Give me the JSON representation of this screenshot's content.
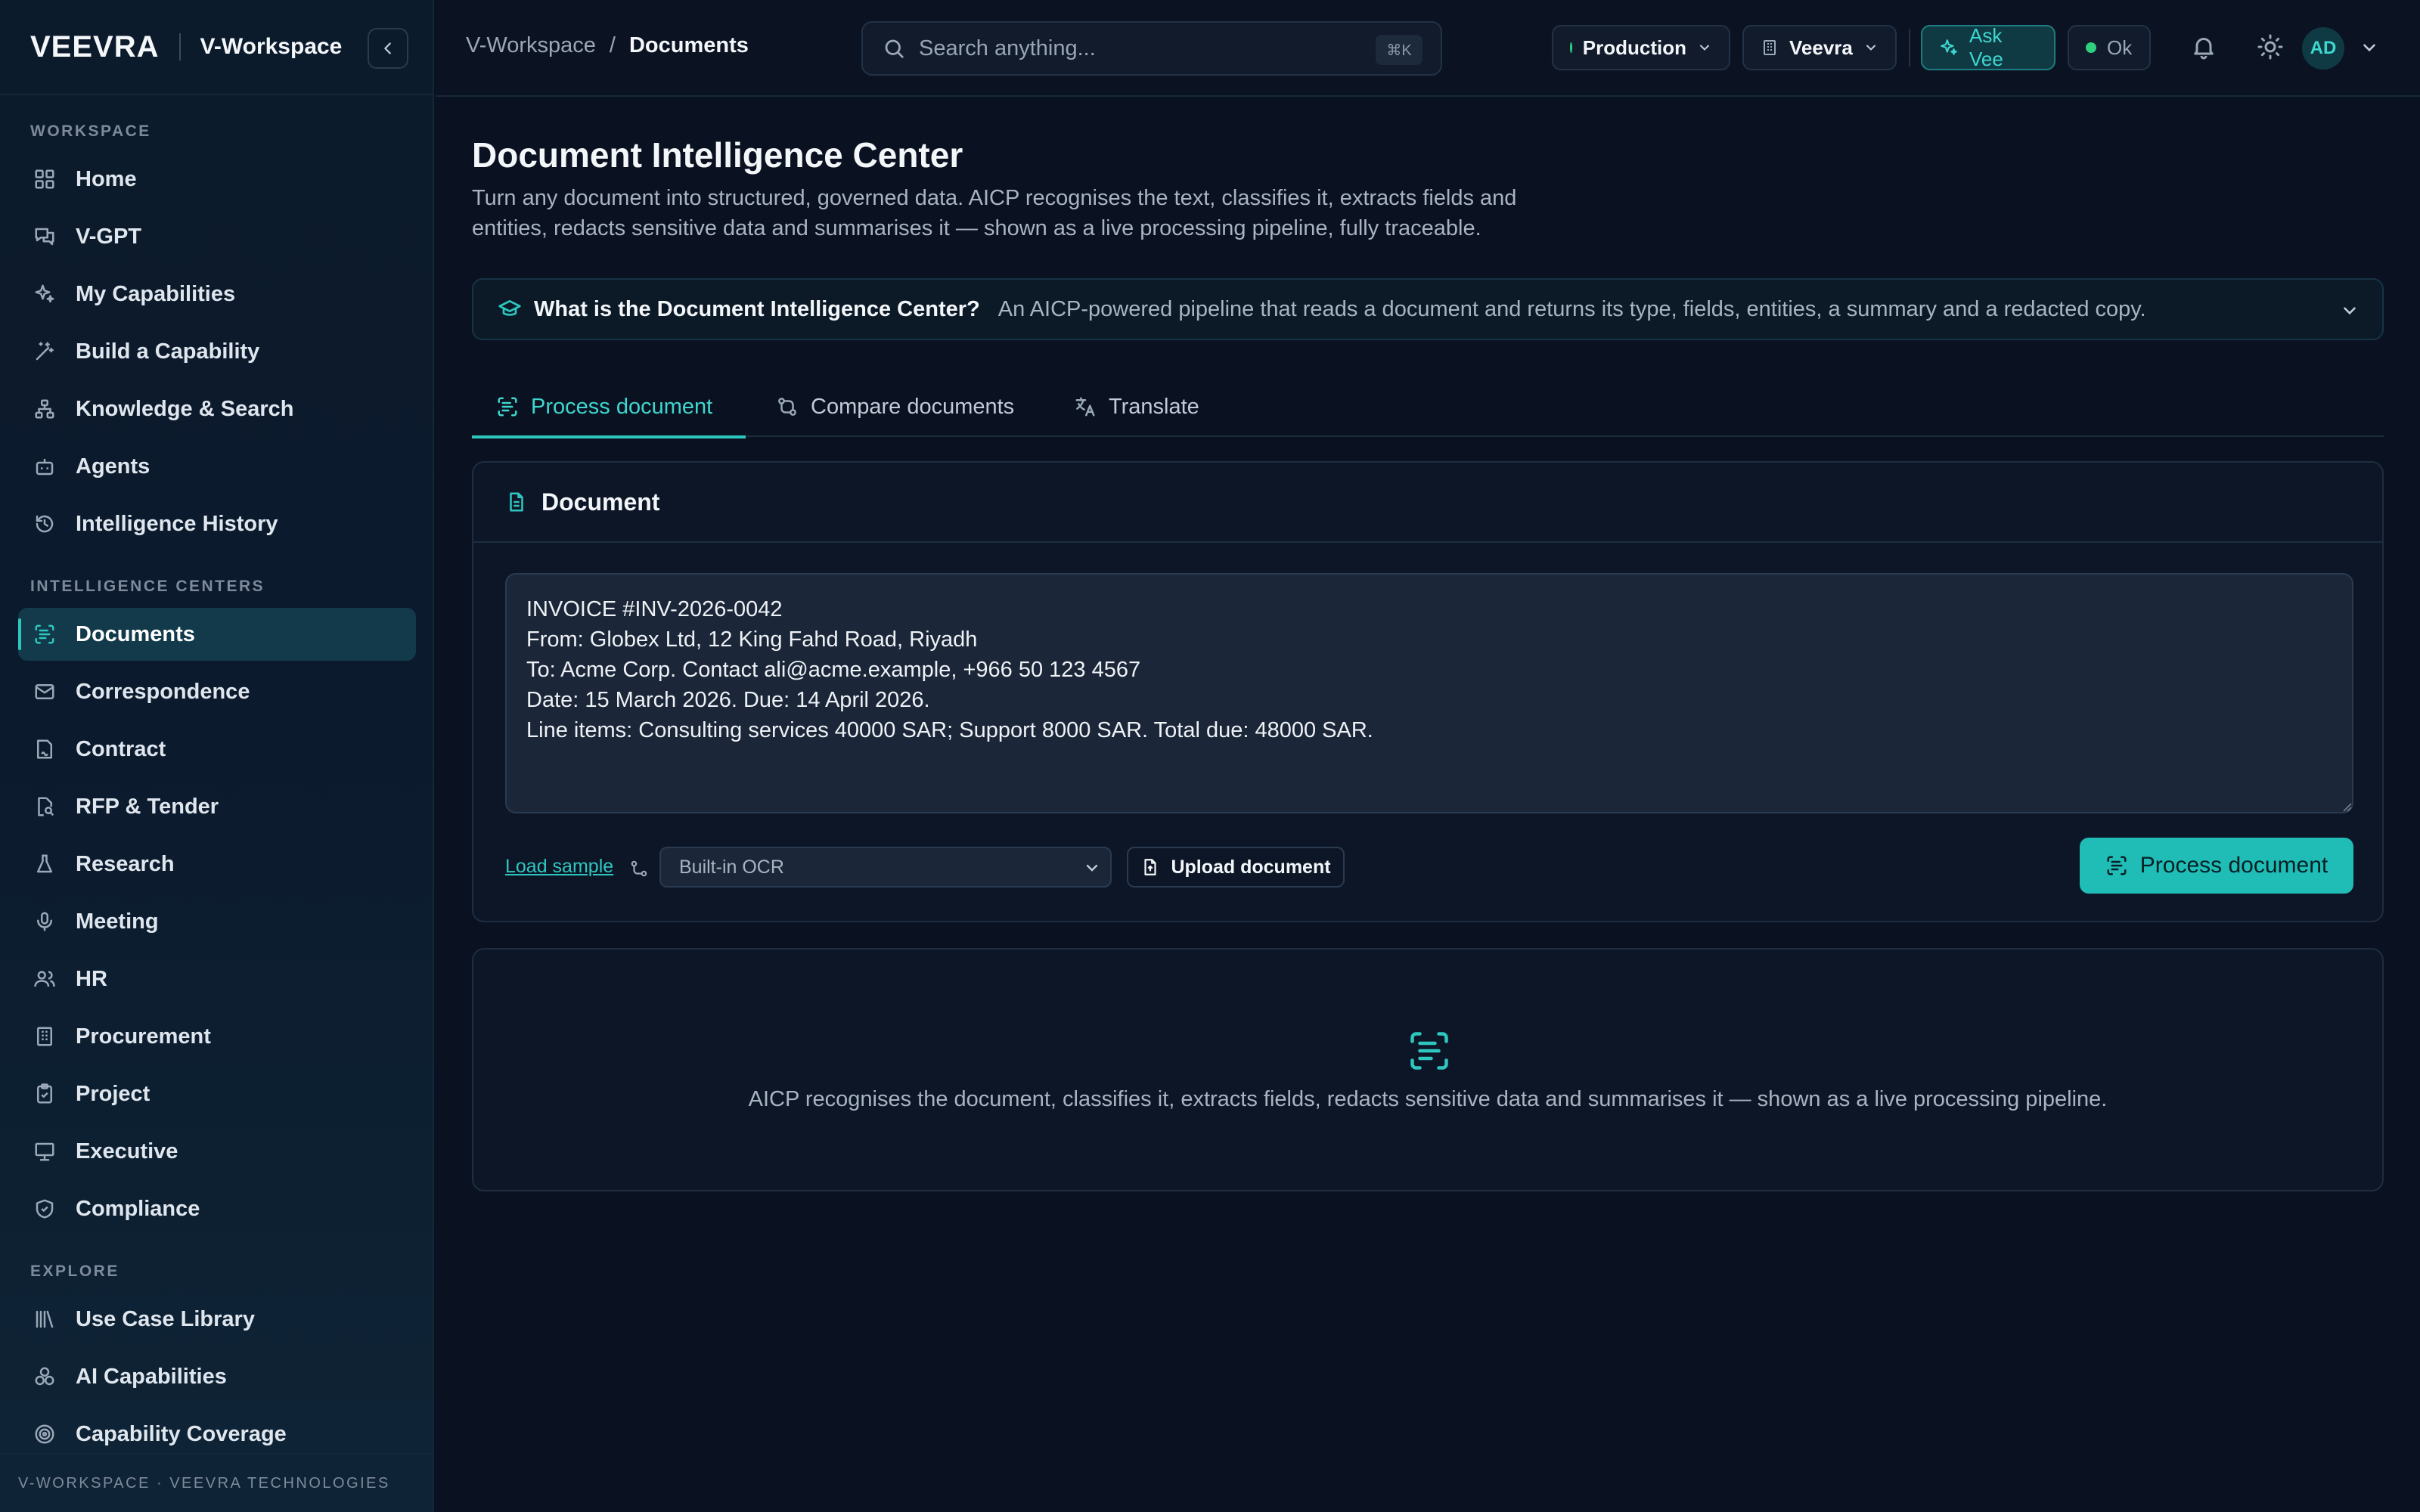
{
  "brand": {
    "logo": "VEEVRA",
    "workspace": "V-Workspace"
  },
  "sidebar": {
    "sections": [
      {
        "label": "WORKSPACE",
        "items": [
          {
            "label": "Home",
            "icon": "grid-icon"
          },
          {
            "label": "V-GPT",
            "icon": "chat-icon"
          },
          {
            "label": "My Capabilities",
            "icon": "sparkles-icon"
          },
          {
            "label": "Build a Capability",
            "icon": "wand-icon"
          },
          {
            "label": "Knowledge & Search",
            "icon": "network-icon"
          },
          {
            "label": "Agents",
            "icon": "robot-icon"
          },
          {
            "label": "Intelligence History",
            "icon": "history-icon"
          }
        ]
      },
      {
        "label": "INTELLIGENCE CENTERS",
        "items": [
          {
            "label": "Documents",
            "icon": "scan-text-icon",
            "active": true
          },
          {
            "label": "Correspondence",
            "icon": "mail-icon"
          },
          {
            "label": "Contract",
            "icon": "contract-icon"
          },
          {
            "label": "RFP & Tender",
            "icon": "file-search-icon"
          },
          {
            "label": "Research",
            "icon": "flask-icon"
          },
          {
            "label": "Meeting",
            "icon": "mic-icon"
          },
          {
            "label": "HR",
            "icon": "users-icon"
          },
          {
            "label": "Procurement",
            "icon": "building-icon"
          },
          {
            "label": "Project",
            "icon": "clipboard-icon"
          },
          {
            "label": "Executive",
            "icon": "presentation-icon"
          },
          {
            "label": "Compliance",
            "icon": "shield-icon"
          }
        ]
      },
      {
        "label": "EXPLORE",
        "items": [
          {
            "label": "Use Case Library",
            "icon": "library-icon"
          },
          {
            "label": "AI Capabilities",
            "icon": "cubes-icon"
          },
          {
            "label": "Capability Coverage",
            "icon": "target-icon"
          }
        ]
      }
    ],
    "footer": "V-WORKSPACE · VEEVRA TECHNOLOGIES"
  },
  "topbar": {
    "breadcrumb": [
      "V-Workspace",
      "Documents"
    ],
    "search_placeholder": "Search anything...",
    "search_shortcut": "⌘K",
    "environment": "Production",
    "org": "Veevra",
    "ask_label": "Ask Vee",
    "status": "Ok",
    "user_initials": "AD"
  },
  "page": {
    "title": "Document Intelligence Center",
    "description": "Turn any document into structured, governed data. AICP recognises the text, classifies it, extracts fields and entities, redacts sensitive data and summarises it — shown as a live processing pipeline, fully traceable.",
    "info_question": "What is the Document Intelligence Center?",
    "info_answer": "An AICP-powered pipeline that reads a document and returns its type, fields, entities, a summary and a redacted copy.",
    "tabs": [
      {
        "label": "Process document",
        "active": true
      },
      {
        "label": "Compare documents"
      },
      {
        "label": "Translate"
      }
    ]
  },
  "document_card": {
    "title": "Document",
    "text": "INVOICE #INV-2026-0042\nFrom: Globex Ltd, 12 King Fahd Road, Riyadh\nTo: Acme Corp. Contact ali@acme.example, +966 50 123 4567\nDate: 15 March 2026. Due: 14 April 2026.\nLine items: Consulting services 40000 SAR; Support 8000 SAR. Total due: 48000 SAR.",
    "load_sample": "Load sample",
    "ocr_option": "Built-in OCR",
    "upload_label": "Upload document",
    "process_label": "Process document"
  },
  "empty_state": {
    "text": "AICP recognises the document, classifies it, extracts fields, redacts sensitive data and summarises it — shown as a live processing pipeline."
  },
  "colors": {
    "accent": "#2ec7c0",
    "background": "#0a1120",
    "status_ok": "#2fcf7e"
  }
}
